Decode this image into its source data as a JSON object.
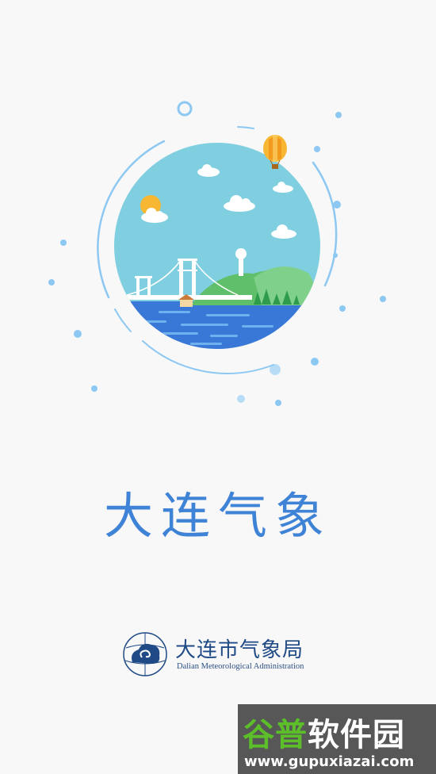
{
  "app": {
    "title": "大连气象"
  },
  "agency": {
    "name_cn": "大连市气象局",
    "name_en": "Dalian Meteorological Administration",
    "logo_icon": "cloud-swirl-globe-icon"
  },
  "illustration": {
    "subject": "dalian-bridge-landscape",
    "icons": [
      "sun-icon",
      "cloud-icon",
      "hot-air-balloon-icon",
      "radar-tower-icon",
      "suspension-bridge-icon"
    ]
  },
  "watermark": {
    "part1": "谷普",
    "part2": "软件园",
    "url": "www.gupuxiazai.com"
  },
  "colors": {
    "background": "#f8f8f8",
    "title_blue": "#3f83d6",
    "sky": "#7fcfe0",
    "sea": "#3a78d8",
    "hill_green": "#5fbf6a",
    "dot_blue": "#8dc8f3",
    "agency_navy": "#1f4a86"
  }
}
